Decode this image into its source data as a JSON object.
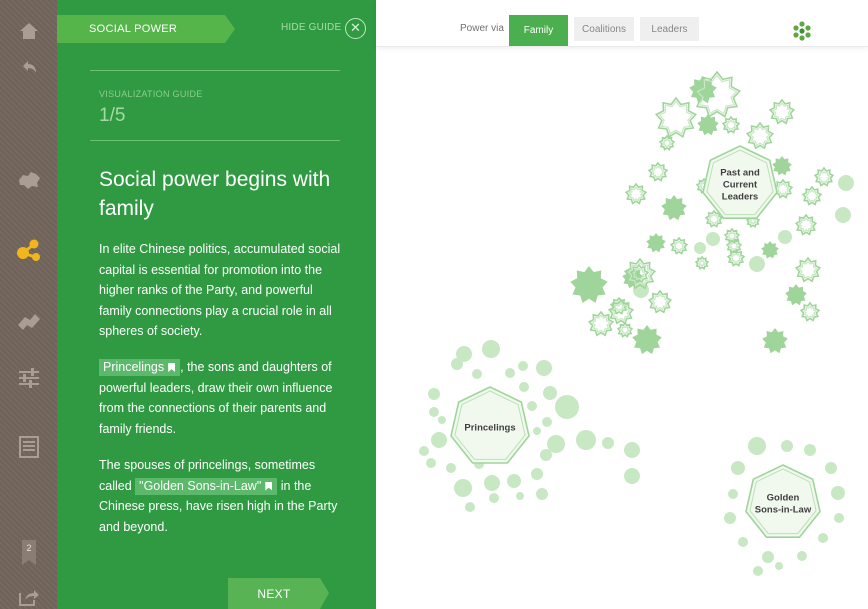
{
  "rail": {
    "badge": "2",
    "items": [
      "home-icon",
      "back-icon",
      "map-icon",
      "network-icon",
      "handshake-icon",
      "sliders-icon",
      "document-icon",
      "bookmark-icon",
      "share-icon"
    ]
  },
  "guide": {
    "section": "SOCIAL POWER",
    "hide": "HIDE GUIDE",
    "close": "✕",
    "label": "VISUALIZATION GUIDE",
    "step": "1/5",
    "heading": "Social power begins with family",
    "p1": "In elite Chinese politics, accumulated social capital is essential for promotion into the higher ranks of the Party, and powerful family connections play a crucial role in all spheres of society.",
    "p2_tag": "Princelings",
    "p2_rest": ", the sons and daughters of powerful leaders, draw their own influence from the connections of their parents and family friends.",
    "p3_before": "The spouses of princelings, sometimes called ",
    "p3_tag": "\"Golden Sons-in-Law\"",
    "p3_after": " in the Chinese press, have risen high in the Party and beyond.",
    "next": "NEXT"
  },
  "toolbar": {
    "label": "Power via",
    "tabs": [
      "Family",
      "Coalitions",
      "Leaders"
    ],
    "active_tab": "Family"
  },
  "network": {
    "clusters": [
      "Past and\nCurrent\nLeaders",
      "Princelings",
      "Golden\nSons-in-Law"
    ]
  },
  "colors": {
    "panel": "#2f9a42",
    "accent": "#4caf4f",
    "node_dark": "#9fd59b",
    "node_light": "#c8e8c4"
  }
}
